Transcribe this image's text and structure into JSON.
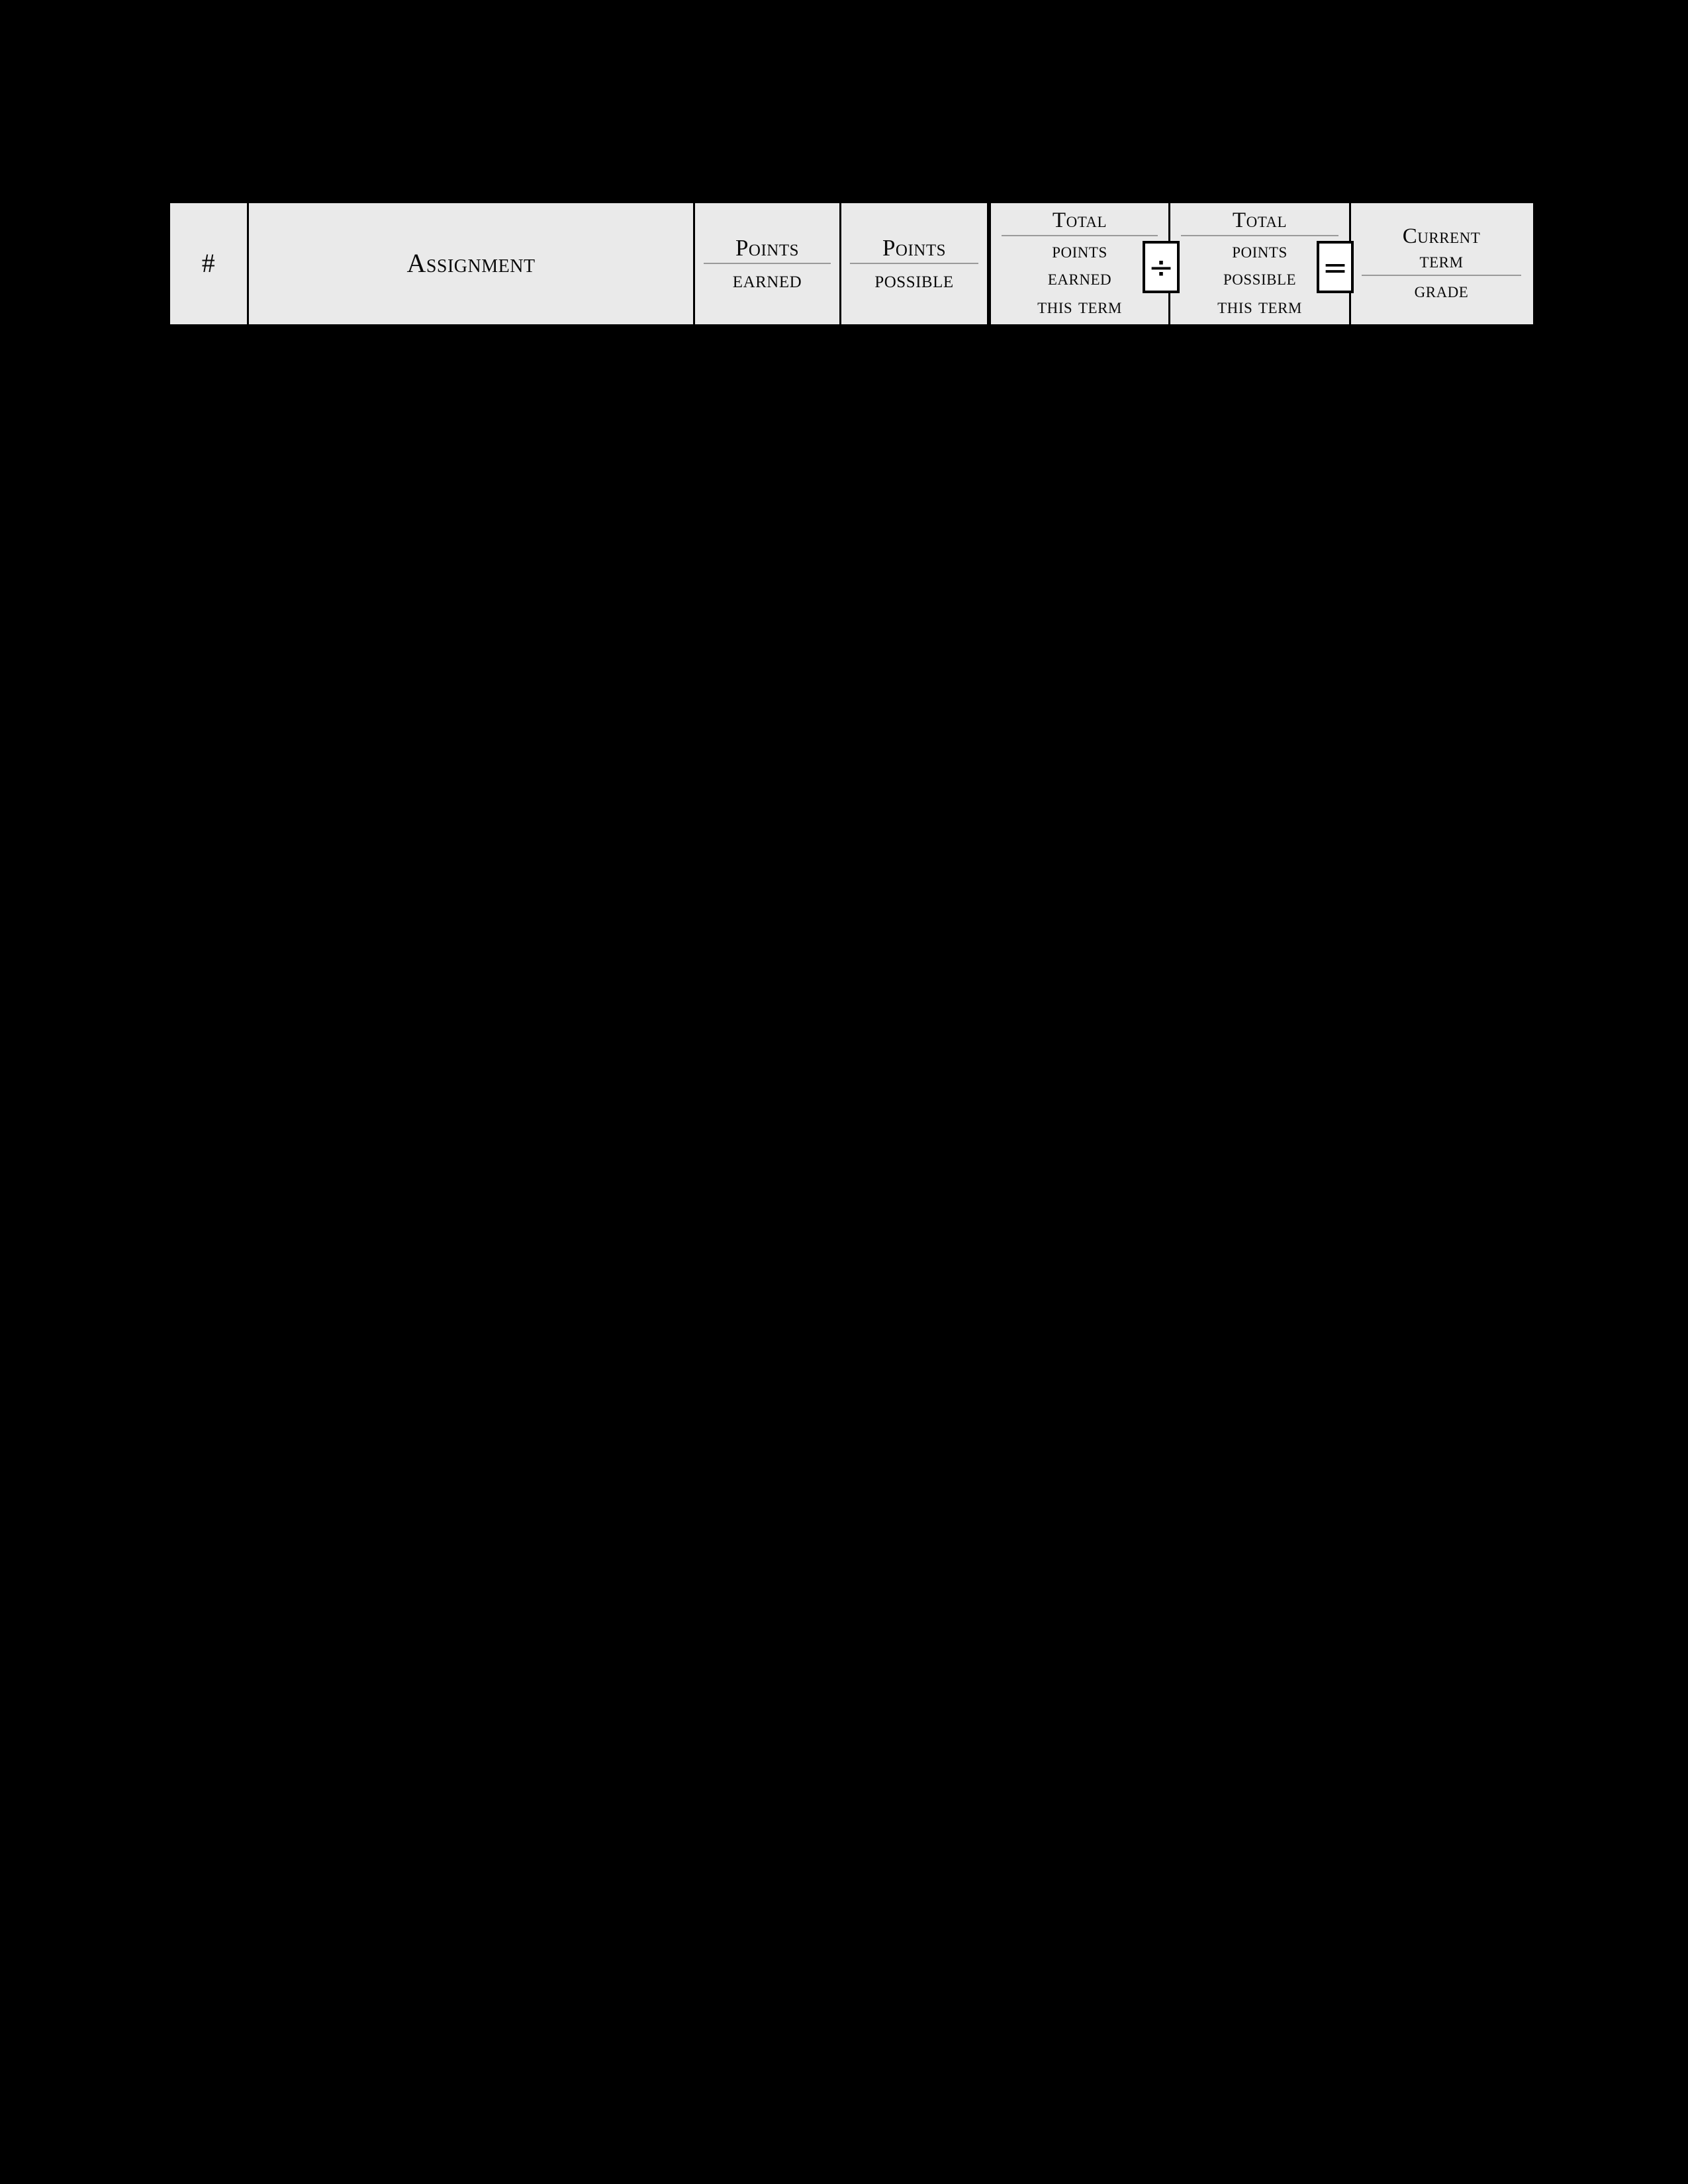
{
  "table": {
    "name": "gradebook-header-table",
    "background_color": "#eaeaea",
    "border_color": "#000000",
    "page_background": "#000000",
    "columns": [
      {
        "key": "number",
        "header": "#",
        "lines": [
          "#"
        ],
        "rule": false
      },
      {
        "key": "assignment",
        "header": "Assignment",
        "lines": [
          "Assignment"
        ],
        "rule": false
      },
      {
        "key": "points_earned",
        "header": "Points earned",
        "top": "Points",
        "bottom": "earned",
        "rule": true
      },
      {
        "key": "points_possible",
        "header": "Points possible",
        "top": "Points",
        "bottom": "possible",
        "rule": true
      },
      {
        "key": "total_points_earned_this_term",
        "header": "Total points earned this term",
        "top": "Total",
        "bottom": "points",
        "bottom2": "earned",
        "tail": "this term",
        "rule": true
      },
      {
        "key": "total_points_possible_this_term",
        "header": "Total points possible this term",
        "top": "Total",
        "bottom": "points",
        "bottom2": "possible",
        "tail": "this term",
        "rule": true
      },
      {
        "key": "current_term_grade",
        "header": "Current term grade",
        "top": "Current",
        "top2": "term",
        "bottom": "grade",
        "rule": true
      }
    ],
    "operators": [
      {
        "key": "divide",
        "symbol": "÷",
        "name": "division-operator"
      },
      {
        "key": "equals",
        "symbol": "=",
        "name": "equals-operator"
      }
    ]
  }
}
